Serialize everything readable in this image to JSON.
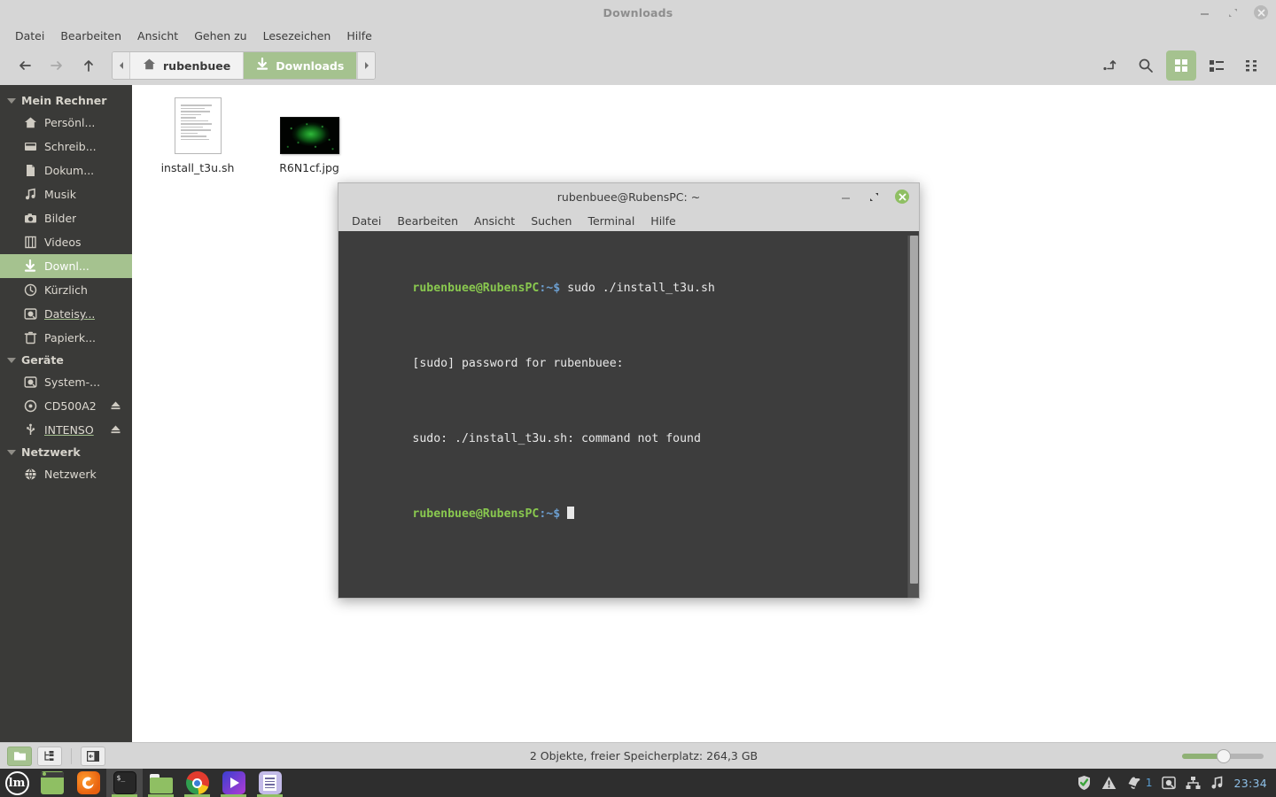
{
  "file_manager": {
    "title": "Downloads",
    "window_controls": [
      "minimize",
      "maximize",
      "close"
    ],
    "menubar": [
      "Datei",
      "Bearbeiten",
      "Ansicht",
      "Gehen zu",
      "Lesezeichen",
      "Hilfe"
    ],
    "toolbar": {
      "back": "back-arrow",
      "forward": "forward-arrow",
      "up": "up-arrow",
      "path_prev": "left-chevron",
      "path_next": "right-chevron",
      "breadcrumbs": [
        {
          "label": "rubenbuee",
          "icon": "home-icon",
          "active": false
        },
        {
          "label": "Downloads",
          "icon": "download-icon",
          "active": true
        }
      ],
      "right_buttons": [
        {
          "name": "path-entry-toggle",
          "icon": "path-entry-icon",
          "active": false
        },
        {
          "name": "search",
          "icon": "search-icon",
          "active": false
        },
        {
          "name": "icon-view",
          "icon": "grid-icon",
          "active": true
        },
        {
          "name": "list-view",
          "icon": "list-icon",
          "active": false
        },
        {
          "name": "compact-view",
          "icon": "compact-icon",
          "active": false
        }
      ]
    },
    "sidebar": {
      "groups": [
        {
          "title": "Mein Rechner",
          "items": [
            {
              "label": "Persönl...",
              "icon": "home-icon",
              "selected": false,
              "underlined": false,
              "eject": false
            },
            {
              "label": "Schreib...",
              "icon": "desktop-icon",
              "selected": false,
              "underlined": false,
              "eject": false
            },
            {
              "label": "Dokum...",
              "icon": "document-icon",
              "selected": false,
              "underlined": false,
              "eject": false
            },
            {
              "label": "Musik",
              "icon": "music-icon",
              "selected": false,
              "underlined": false,
              "eject": false
            },
            {
              "label": "Bilder",
              "icon": "camera-icon",
              "selected": false,
              "underlined": false,
              "eject": false
            },
            {
              "label": "Videos",
              "icon": "film-icon",
              "selected": false,
              "underlined": false,
              "eject": false
            },
            {
              "label": "Downl...",
              "icon": "download-icon",
              "selected": true,
              "underlined": false,
              "eject": false
            },
            {
              "label": "Kürzlich",
              "icon": "clock-icon",
              "selected": false,
              "underlined": false,
              "eject": false
            },
            {
              "label": "Dateisy...",
              "icon": "harddisk-icon",
              "selected": false,
              "underlined": true,
              "eject": false
            },
            {
              "label": "Papierk...",
              "icon": "trash-icon",
              "selected": false,
              "underlined": false,
              "eject": false
            }
          ]
        },
        {
          "title": "Geräte",
          "items": [
            {
              "label": "System-...",
              "icon": "harddisk-icon",
              "selected": false,
              "underlined": false,
              "eject": false
            },
            {
              "label": "CD500A2",
              "icon": "disc-icon",
              "selected": false,
              "underlined": false,
              "eject": true
            },
            {
              "label": "INTENSO",
              "icon": "usb-icon",
              "selected": false,
              "underlined": true,
              "eject": true
            }
          ]
        },
        {
          "title": "Netzwerk",
          "items": [
            {
              "label": "Netzwerk",
              "icon": "globe-icon",
              "selected": false,
              "underlined": false,
              "eject": false
            }
          ]
        }
      ]
    },
    "files": [
      {
        "name": "install_t3u.sh",
        "type": "script"
      },
      {
        "name": "R6N1cf.jpg",
        "type": "image"
      }
    ],
    "statusbar": {
      "buttons": [
        {
          "name": "places-view",
          "icon": "folder-icon",
          "active": true
        },
        {
          "name": "tree-view",
          "icon": "tree-icon",
          "active": false
        },
        {
          "name": "toggle-sidebar",
          "icon": "sidebar-toggle-icon",
          "active": false
        }
      ],
      "text": "2 Objekte, freier Speicherplatz: 264,3 GB",
      "zoom_percent": 45
    }
  },
  "terminal": {
    "title": "rubenbuee@RubensPC: ~",
    "menubar": [
      "Datei",
      "Bearbeiten",
      "Ansicht",
      "Suchen",
      "Terminal",
      "Hilfe"
    ],
    "lines": [
      {
        "prompt_user": "rubenbuee@RubensPC",
        "prompt_path": ":~$ ",
        "text": "sudo ./install_t3u.sh"
      },
      {
        "prompt_user": "",
        "prompt_path": "",
        "text": "[sudo] password for rubenbuee:"
      },
      {
        "prompt_user": "",
        "prompt_path": "",
        "text": "sudo: ./install_t3u.sh: command not found"
      },
      {
        "prompt_user": "rubenbuee@RubensPC",
        "prompt_path": ":~$ ",
        "text": "",
        "cursor": true
      }
    ]
  },
  "taskbar": {
    "menu_button": "lm",
    "launchers": [
      {
        "name": "show-desktop",
        "icon": "window-icon",
        "focused": false,
        "running": false
      },
      {
        "name": "firefox",
        "icon": "firefox-icon",
        "focused": false,
        "running": false
      },
      {
        "name": "terminal",
        "icon": "terminal-icon",
        "focused": true,
        "running": true
      },
      {
        "name": "file-manager",
        "icon": "folder-icon",
        "focused": false,
        "running": true
      },
      {
        "name": "chrome",
        "icon": "chrome-icon",
        "focused": false,
        "running": true
      },
      {
        "name": "media-player",
        "icon": "media-player-icon",
        "focused": false,
        "running": true
      },
      {
        "name": "text-editor",
        "icon": "text-editor-icon",
        "focused": false,
        "running": true
      }
    ],
    "tray": [
      {
        "name": "security-shield",
        "icon": "shield-check-icon",
        "badge": ""
      },
      {
        "name": "update-manager",
        "icon": "warning-icon",
        "badge": ""
      },
      {
        "name": "notifications",
        "icon": "bell-icon",
        "badge": "1"
      },
      {
        "name": "disk-usage",
        "icon": "harddisk-icon",
        "badge": ""
      },
      {
        "name": "network",
        "icon": "network-icon",
        "badge": ""
      },
      {
        "name": "sound",
        "icon": "music-note-icon",
        "badge": ""
      }
    ],
    "clock": "23:34"
  },
  "colors": {
    "accent_green": "#a5c28f",
    "sidebar_bg": "#3a3a38",
    "chrome_bg": "#d6d6d6",
    "terminal_bg": "#3d3d3d",
    "taskbar_bg": "#2e2e2e"
  }
}
